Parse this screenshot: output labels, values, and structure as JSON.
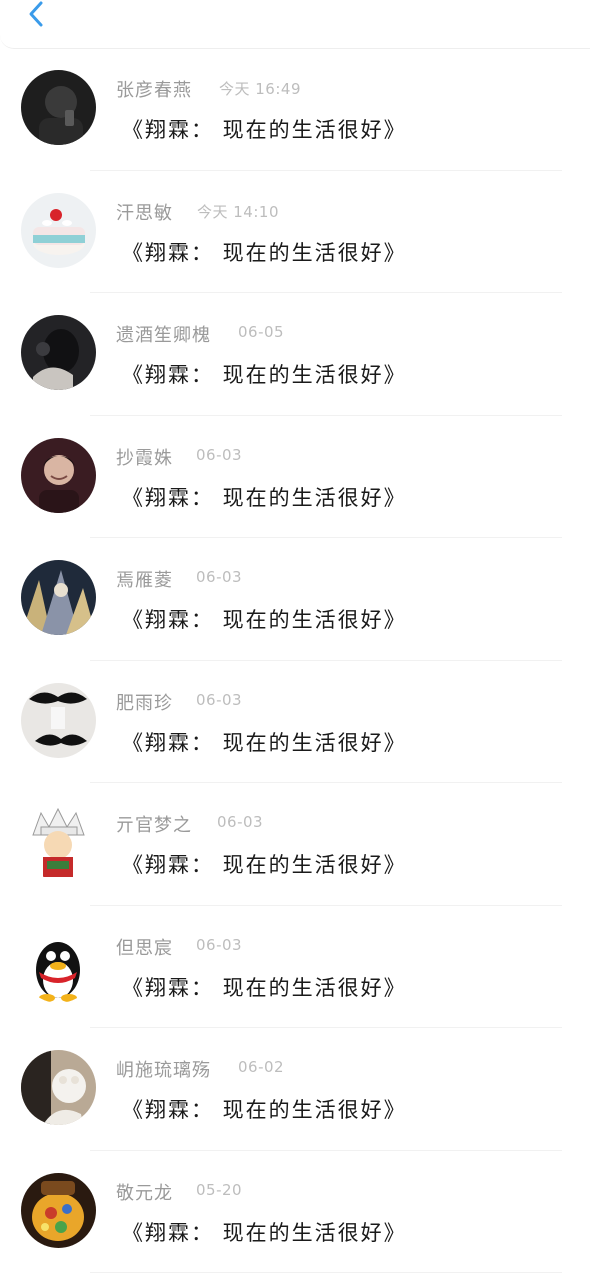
{
  "header": {
    "back_icon": "chevron-left-icon",
    "accent_color": "#3a9bea"
  },
  "conversations": [
    {
      "name": "张彦春燕",
      "time": "今天 16:49",
      "message": "《翔霖： 现在的生活很好》",
      "avatar": "dark-phone-selfie"
    },
    {
      "name": "汗思敏",
      "time": "今天 14:10",
      "message": "《翔霖： 现在的生活很好》",
      "avatar": "strawberry-cake"
    },
    {
      "name": "遗酒笙卿槐",
      "time": "06-05",
      "message": "《翔霖： 现在的生活很好》",
      "avatar": "dark-portrait"
    },
    {
      "name": "抄霞姝",
      "time": "06-03",
      "message": "《翔霖： 现在的生活很好》",
      "avatar": "smiling-man"
    },
    {
      "name": "焉雁菱",
      "time": "06-03",
      "message": "《翔霖： 现在的生活很好》",
      "avatar": "fantasy-art"
    },
    {
      "name": "肥雨珍",
      "time": "06-03",
      "message": "《翔霖： 现在的生活很好》",
      "avatar": "mustaches"
    },
    {
      "name": "亓官梦之",
      "time": "06-03",
      "message": "《翔霖： 现在的生活很好》",
      "avatar": "anime-character"
    },
    {
      "name": "但思宸",
      "time": "06-03",
      "message": "《翔霖： 现在的生活很好》",
      "avatar": "penguin"
    },
    {
      "name": "岄施琉璃殇",
      "time": "06-02",
      "message": "《翔霖： 现在的生活很好》",
      "avatar": "girl-with-toy"
    },
    {
      "name": "敬元龙",
      "time": "05-20",
      "message": "《翔霖： 现在的生活很好》",
      "avatar": "colorful-lantern"
    }
  ]
}
